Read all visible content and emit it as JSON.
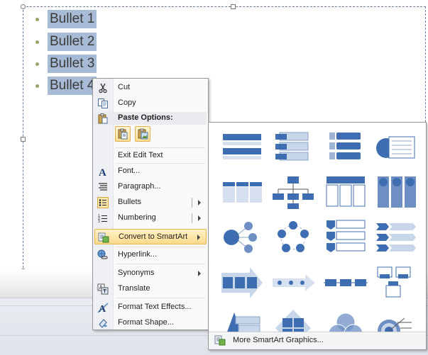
{
  "slide": {
    "bullets": [
      "Bullet 1",
      "Bullet 2",
      "Bullet 3",
      "Bullet 4"
    ]
  },
  "context_menu": {
    "cut": "Cut",
    "copy": "Copy",
    "paste_options": "Paste Options:",
    "exit_edit_text": "Exit Edit Text",
    "font": "Font...",
    "paragraph": "Paragraph...",
    "bullets": "Bullets",
    "numbering": "Numbering",
    "convert_to_smartart": "Convert to SmartArt",
    "hyperlink": "Hyperlink...",
    "synonyms": "Synonyms",
    "translate": "Translate",
    "format_text_effects": "Format Text Effects...",
    "format_shape": "Format Shape..."
  },
  "smartart_gallery": {
    "layouts": [
      "vertical-bullet-list",
      "vertical-box-list",
      "vertical-bracket-list",
      "trapezoid-list",
      "horizontal-bullet-list",
      "organization-chart",
      "table-list",
      "stacked-list",
      "radial-cluster",
      "basic-cycle",
      "vertical-chevron-list",
      "chevron-list",
      "basic-process",
      "continuous-arrow-process",
      "basic-timeline",
      "hierarchy-list",
      "basic-pyramid",
      "basic-matrix",
      "basic-venn",
      "target"
    ],
    "more_label": "More SmartArt Graphics..."
  },
  "colors": {
    "selection": "#a7bbd6",
    "menu_highlight": "#fbd98a",
    "smartart_blue": "#3f6db1"
  }
}
